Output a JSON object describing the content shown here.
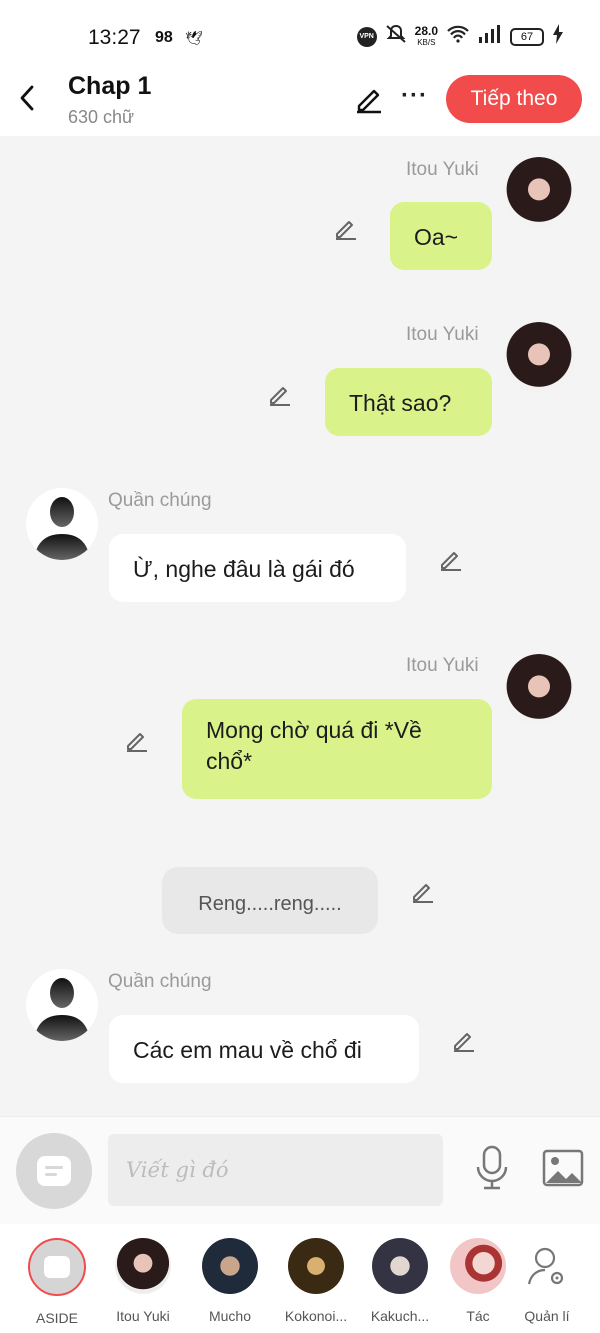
{
  "status_bar": {
    "time": "13:27",
    "notif_count": "98",
    "vpn": "VPN",
    "speed": "28.0",
    "speed_unit": "KB/S",
    "battery": "67"
  },
  "header": {
    "title": "Chap 1",
    "subtitle": "630 chữ",
    "next_button": "Tiếp theo"
  },
  "messages": [
    {
      "sender": "Itou Yuki",
      "text": "Oa~"
    },
    {
      "sender": "Itou Yuki",
      "text": "Thật sao?"
    },
    {
      "sender": "Quần chúng",
      "text": "Ừ, nghe đâu là gái đó"
    },
    {
      "sender": "Itou Yuki",
      "text": "Mong chờ quá đi *Về chổ*"
    },
    {
      "sender": "",
      "text": "Reng.....reng....."
    },
    {
      "sender": "Quần chúng",
      "text": "Các em mau về chổ đi"
    }
  ],
  "input": {
    "placeholder": "Viết gì đó"
  },
  "nav": [
    {
      "label": "ASIDE"
    },
    {
      "label": "Itou Yuki"
    },
    {
      "label": "Mucho"
    },
    {
      "label": "Kokonoi..."
    },
    {
      "label": "Kakuch..."
    },
    {
      "label": "Tác"
    },
    {
      "label": "Quản lí"
    }
  ],
  "colors": {
    "accent": "#f24b4b",
    "bubble_green": "#d9f38a",
    "bubble_white": "#ffffff",
    "background": "#f4f4f4"
  }
}
